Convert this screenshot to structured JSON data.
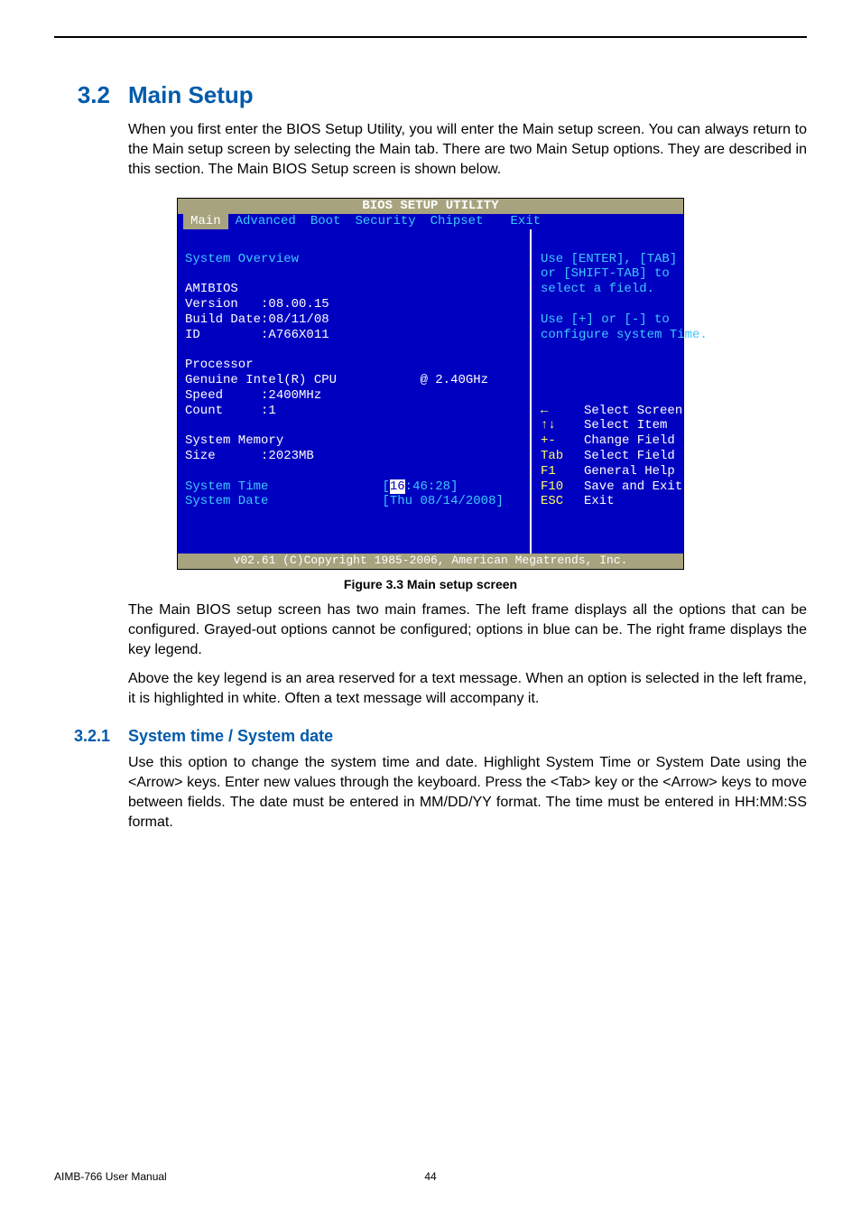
{
  "heading": {
    "number": "3.2",
    "title": "Main Setup"
  },
  "intro": "When you first enter the BIOS Setup Utility, you will enter the Main setup screen. You can always return to the Main setup screen by selecting the Main tab. There are two Main Setup options. They are described in this section. The Main BIOS Setup screen is shown below.",
  "bios": {
    "title": "BIOS SETUP UTILITY",
    "tabs": [
      "Main",
      "Advanced",
      "Boot",
      "Security",
      "Chipset",
      "Exit"
    ],
    "active_tab": "Main",
    "left": {
      "section1": "System Overview",
      "amibios_label": "AMIBIOS",
      "version_row": "Version   :08.00.15",
      "build_row": "Build Date:08/11/08",
      "id_row": "ID        :A766X011",
      "proc_label": "Processor",
      "proc_name_row": "Genuine Intel(R) CPU           @ 2.40GHz",
      "speed_row": "Speed     :2400MHz",
      "count_row": "Count     :1",
      "mem_label": "System Memory",
      "size_row": "Size      :2023MB",
      "time_label": "System Time",
      "time_value_prefix": "[",
      "time_value_hl": "16",
      "time_value_rest": ":46:28]",
      "date_label": "System Date",
      "date_value": "[Thu 08/14/2008]"
    },
    "right": {
      "msg1": "Use [ENTER], [TAB]",
      "msg2": "or [SHIFT-TAB] to",
      "msg3": "select a field.",
      "msg4": "Use [+] or [-] to",
      "msg5": "configure system Time.",
      "legend": [
        {
          "key": "←",
          "label": "Select Screen"
        },
        {
          "key": "↑↓",
          "label": "Select Item"
        },
        {
          "key": "+-",
          "label": "Change Field"
        },
        {
          "key": "Tab",
          "label": "Select Field"
        },
        {
          "key": "F1",
          "label": "General Help"
        },
        {
          "key": "F10",
          "label": "Save and Exit"
        },
        {
          "key": "ESC",
          "label": "Exit"
        }
      ]
    },
    "footer": "v02.61 (C)Copyright 1985-2006, American Megatrends, Inc."
  },
  "figure_caption": "Figure 3.3 Main setup screen",
  "para2": "The Main BIOS setup screen has two main frames. The left frame displays all the options that can be configured. Grayed-out options cannot be configured; options in blue can be. The right frame displays the key legend.",
  "para3": "Above the key legend is an area reserved for a text message. When an option is selected in the left frame, it is highlighted in white. Often a text message will accompany it.",
  "subheading": {
    "number": "3.2.1",
    "title": "System time / System date"
  },
  "para4": "Use this option to change the system time and date. Highlight System Time or System Date using the <Arrow> keys. Enter new values through the keyboard. Press the <Tab> key or the <Arrow> keys to move between fields. The date must be entered in MM/DD/YY format. The time must be entered in HH:MM:SS format.",
  "footer": {
    "manual": "AIMB-766 User Manual",
    "page": "44"
  }
}
